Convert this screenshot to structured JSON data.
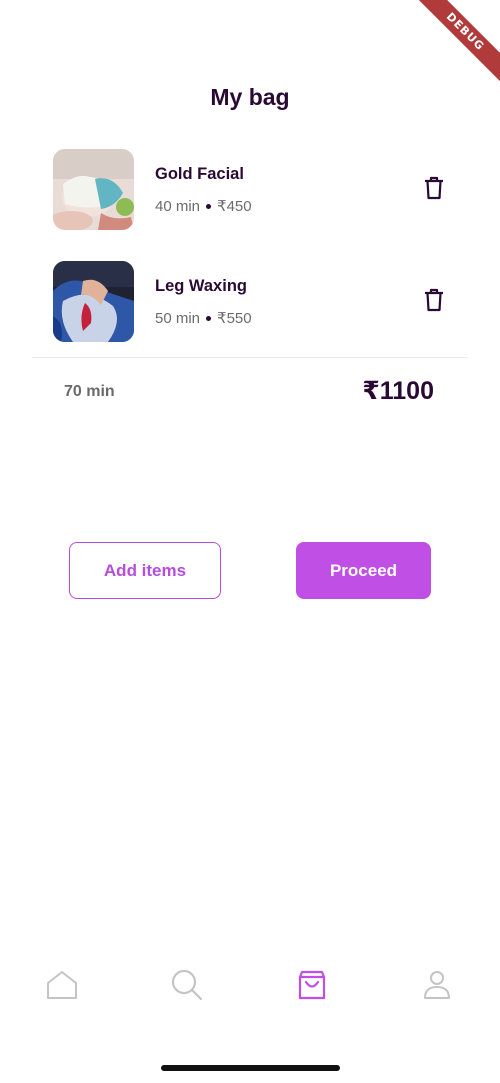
{
  "debug_banner": "DEBUG",
  "page": {
    "title": "My bag"
  },
  "bag": {
    "items": [
      {
        "name": "Gold Facial",
        "duration": "40 min",
        "price": "₹450",
        "thumb_icon": "facial-photo"
      },
      {
        "name": "Leg Waxing",
        "duration": "50 min",
        "price": "₹550",
        "thumb_icon": "waxing-photo"
      }
    ],
    "total_duration": "70 min",
    "total_price": "₹1100"
  },
  "actions": {
    "add_items": "Add items",
    "proceed": "Proceed"
  },
  "nav": {
    "items": [
      {
        "icon": "home-icon",
        "active": false
      },
      {
        "icon": "search-icon",
        "active": false
      },
      {
        "icon": "bag-icon",
        "active": true
      },
      {
        "icon": "profile-icon",
        "active": false
      }
    ]
  },
  "colors": {
    "accent": "#c04fe6",
    "title": "#2a0a33",
    "muted": "#6c6c6c",
    "nav_inactive": "#c4c4c4",
    "debug": "#b13b3b"
  }
}
